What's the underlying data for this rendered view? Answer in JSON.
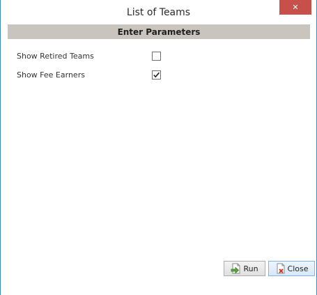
{
  "window": {
    "title": "List of Teams",
    "close_glyph": "✕"
  },
  "section": {
    "header": "Enter Parameters"
  },
  "parameters": [
    {
      "label": "Show Retired Teams",
      "checked": false
    },
    {
      "label": "Show Fee Earners",
      "checked": true
    }
  ],
  "buttons": {
    "run_label": "Run",
    "run_icon": "document-run-icon",
    "close_label": "Close",
    "close_icon": "document-close-icon"
  },
  "colors": {
    "title_close_bg": "#c7504b",
    "section_header_bg": "#c9c4be",
    "window_border": "#3c89c8"
  }
}
